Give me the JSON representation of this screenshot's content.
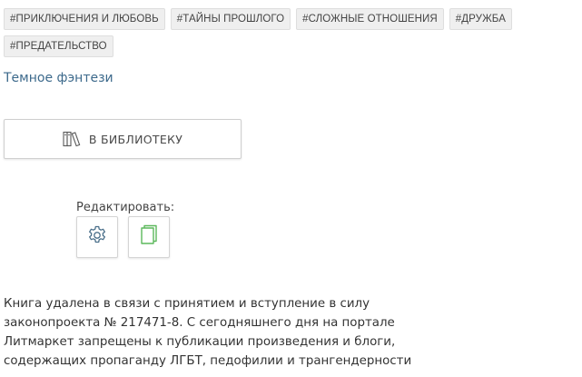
{
  "tags": [
    "#ПРИКЛЮЧЕНИЯ И ЛЮБОВЬ",
    "#ТАЙНЫ ПРОШЛОГО",
    "#СЛОЖНЫЕ ОТНОШЕНИЯ",
    "#ДРУЖБА",
    "#ПРЕДАТЕЛЬСТВО"
  ],
  "genre": {
    "label": "Темное фэнтези",
    "color": "#3d6a8c"
  },
  "library_button": {
    "label": "В БИБЛИОТЕКУ",
    "icon": "books-icon"
  },
  "edit": {
    "label": "Редактировать:",
    "settings_icon": "gear-icon",
    "book_icon": "book-icon",
    "icon_colors": {
      "gear": "#4a6f8a",
      "book": "#5cb85c"
    }
  },
  "notice": {
    "lines": [
      "Книга удалена в связи с принятием и вступление в силу",
      "законопроекта № 217471-8. С сегодняшнего дня на портале",
      "Литмаркет запрещены к публикации произведения и блоги,",
      "содержащих пропаганду ЛГБТ, педофилии и трангендерности"
    ]
  }
}
